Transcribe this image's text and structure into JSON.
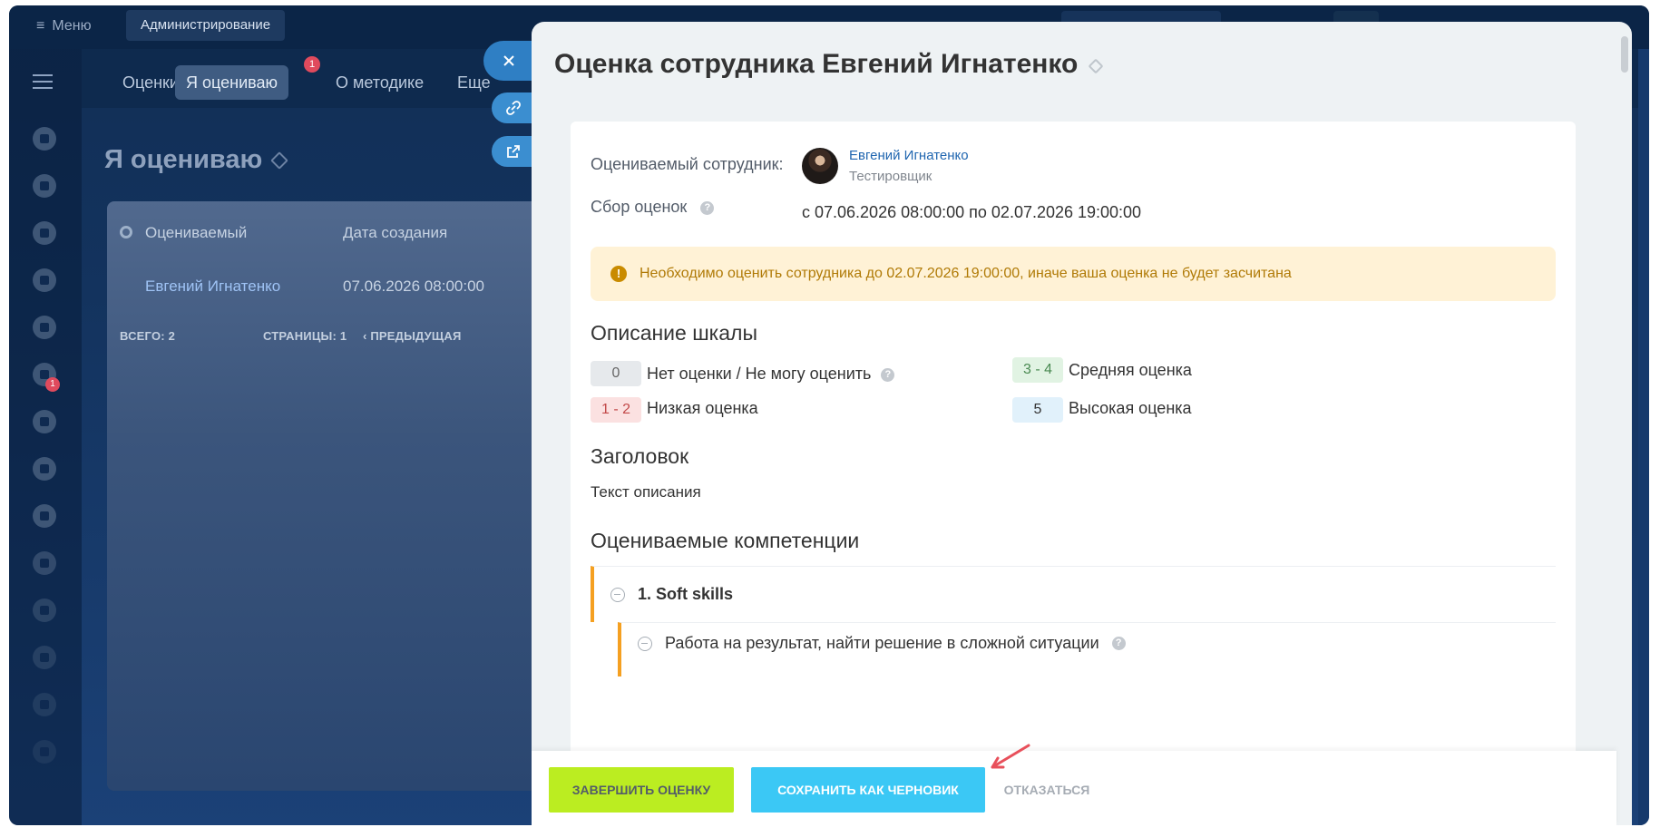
{
  "topbar": {
    "menu_label": "Меню",
    "admin_label": "Администрирование"
  },
  "subnav": {
    "tabs": [
      {
        "label": "Оценки"
      },
      {
        "label": "Я оцениваю",
        "badge": "1"
      },
      {
        "label": "О методике"
      },
      {
        "label": "Еще"
      }
    ]
  },
  "leftnav": {
    "badge": "1"
  },
  "background_page": {
    "title": "Я оцениваю",
    "table": {
      "columns": [
        "Оцениваемый",
        "Дата создания"
      ],
      "rows": [
        {
          "employee": "Евгений Игнатенко",
          "created": "07.06.2026 08:00:00"
        }
      ],
      "footer": {
        "total": "ВСЕГО: 2",
        "pages": "СТРАНИЦЫ:  1",
        "prev": "ПРЕДЫДУЩАЯ"
      }
    }
  },
  "panel": {
    "title": "Оценка сотрудника Евгений Игнатенко",
    "employee_label": "Оцениваемый сотрудник:",
    "employee_name": "Евгений Игнатенко",
    "employee_position": "Тестировщик",
    "collection_label": "Сбор оценок",
    "collection_period": "с 07.06.2026 08:00:00 по 02.07.2026 19:00:00",
    "warning": "Необходимо оценить сотрудника до 02.07.2026 19:00:00, иначе ваша оценка не будет засчитана",
    "scale": {
      "title": "Описание шкалы",
      "items": [
        {
          "value": "0",
          "label": "Нет оценки / Не могу оценить",
          "color": "#e6e9ec"
        },
        {
          "value": "1 - 2",
          "label": "Низкая оценка",
          "color": "#fbe1e1"
        },
        {
          "value": "3 - 4",
          "label": "Средняя оценка",
          "color": "#e1f3e3"
        },
        {
          "value": "5",
          "label": "Высокая оценка",
          "color": "#e1f1fb"
        }
      ]
    },
    "header_title": "Заголовок",
    "header_text": "Текст описания",
    "competencies": {
      "title": "Оцениваемые компетенции",
      "group": "1. Soft skills",
      "item": "Работа на результат, найти решение в сложной ситуации"
    }
  },
  "footer": {
    "finish": "Завершить оценку",
    "draft": "Сохранить как черновик",
    "cancel": "Отказаться"
  },
  "colors": {
    "accent_green": "#bbed21",
    "accent_blue": "#3bc8f5",
    "competency_border": "#f5a021",
    "link": "#2066b0"
  }
}
